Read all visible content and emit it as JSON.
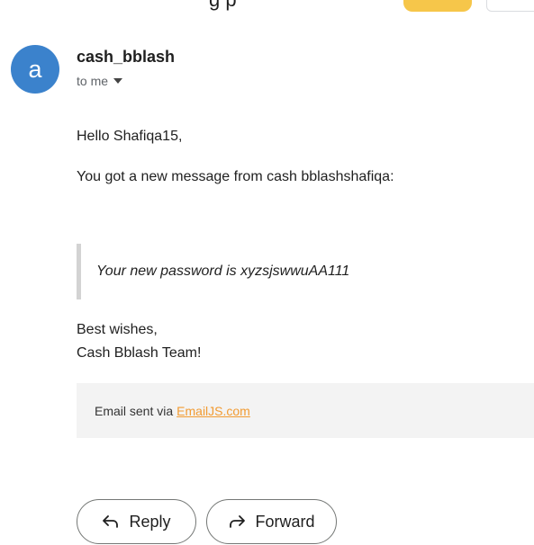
{
  "header": {
    "partial_title": "g        p"
  },
  "sender": {
    "avatar_letter": "a",
    "avatar_color": "#3b82cc",
    "name": "cash_bblash",
    "recipient_label": "to me"
  },
  "body": {
    "greeting": "Hello Shafiqa15,",
    "intro": "You got a new message from cash bblashshafiqa:",
    "quote": "Your new password is xyzsjswwuAA111",
    "signoff": "Best wishes,",
    "signature": "Cash Bblash Team!"
  },
  "footer": {
    "sent_via_text": "Email sent via",
    "link_text": "EmailJS.com",
    "link_color": "#f29b32"
  },
  "actions": {
    "reply_label": "Reply",
    "forward_label": "Forward"
  },
  "icons": {
    "recipient_caret": "chevron-down-icon",
    "reply": "reply-arrow-icon",
    "forward": "forward-arrow-icon"
  }
}
